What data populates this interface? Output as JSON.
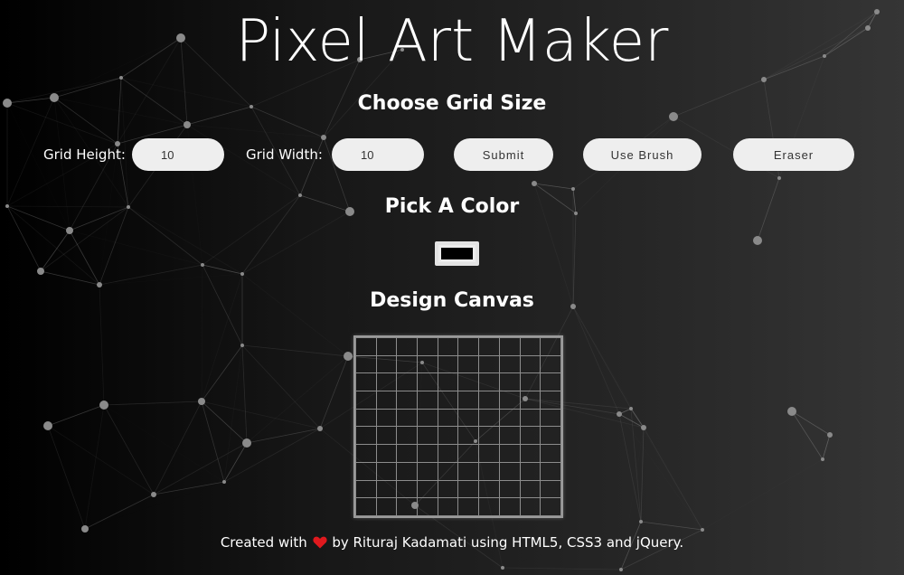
{
  "header": {
    "title": "Pixel Art Maker"
  },
  "grid_size": {
    "heading": "Choose Grid Size",
    "height_label": "Grid Height:",
    "height_value": "10",
    "width_label": "Grid Width:",
    "width_value": "10",
    "submit_label": "Submit",
    "brush_label": "Use Brush",
    "eraser_label": "Eraser"
  },
  "color": {
    "heading": "Pick A Color",
    "selected_value": "#000000"
  },
  "canvas": {
    "heading": "Design Canvas",
    "rows": 10,
    "cols": 10
  },
  "footer": {
    "prefix": "Created with",
    "heart_icon": "heart-icon",
    "suffix": "by Rituraj Kadamati using HTML5, CSS3 and jQuery."
  },
  "colors": {
    "heart": "#e0191e",
    "pill_background": "#eeeeee",
    "grid_line": "#8c8c8c"
  }
}
